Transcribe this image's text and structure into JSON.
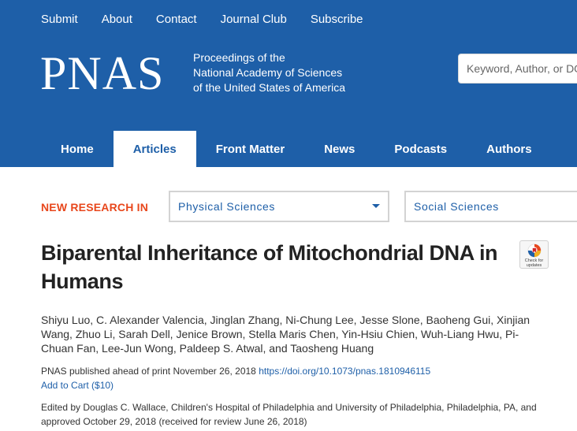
{
  "topnav": [
    "Submit",
    "About",
    "Contact",
    "Journal Club",
    "Subscribe"
  ],
  "logo": "PNAS",
  "tagline": [
    "Proceedings of the",
    "National Academy of Sciences",
    "of the United States of America"
  ],
  "search": {
    "placeholder": "Keyword, Author, or DOI"
  },
  "mainnav": {
    "tabs": [
      "Home",
      "Articles",
      "Front Matter",
      "News",
      "Podcasts",
      "Authors"
    ],
    "active": "Articles"
  },
  "new_research": {
    "label": "NEW RESEARCH IN",
    "selects": [
      "Physical Sciences",
      "Social Sciences"
    ]
  },
  "article": {
    "title": "Biparental Inheritance of Mitochondrial DNA in Humans",
    "check_updates_badge": "Check for updates",
    "authors": "Shiyu Luo, C. Alexander Valencia, Jinglan Zhang, Ni-Chung Lee, Jesse Slone, Baoheng Gui, Xinjian Wang, Zhuo Li, Sarah Dell, Jenice Brown, Stella Maris Chen, Yin-Hsiu Chien, Wuh-Liang Hwu, Pi-Chuan Fan, Lee-Jun Wong, Paldeep S. Atwal, and Taosheng Huang",
    "published_prefix": "PNAS published ahead of print November 26, 2018",
    "doi": "https://doi.org/10.1073/pnas.1810946115",
    "cart": "Add to Cart ($10)",
    "edited_by": "Edited by Douglas C. Wallace, Children's Hospital of Philadelphia and University of Philadelphia, Philadelphia, PA, and approved October 29, 2018 (received for review June 26, 2018)"
  },
  "colors": {
    "brand_blue": "#1e5fa8",
    "accent_orange": "#e8471c"
  }
}
